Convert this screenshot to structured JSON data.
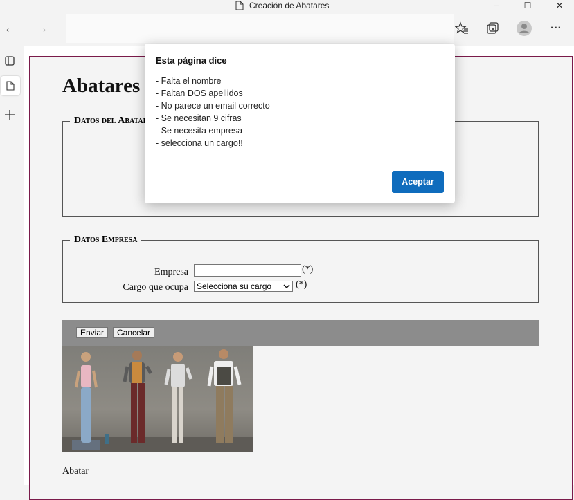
{
  "window": {
    "title": "Creación de Abatares",
    "minimize_icon": "─",
    "maximize_icon": "☐",
    "close_icon": "✕"
  },
  "toolbar": {
    "back_icon": "←",
    "forward_icon": "→",
    "more_icon": "···"
  },
  "page": {
    "title": "Abatares",
    "fieldset_datos_abatar": "Datos del Abatar",
    "fieldset_datos_empresa": "Datos Empresa",
    "empresa_label": "Empresa",
    "empresa_value": "",
    "empresa_required": "(*)",
    "cargo_label": "Cargo que ocupa",
    "cargo_selected": "Selecciona su cargo",
    "cargo_required": "(*)",
    "enviar_label": "Enviar",
    "cancelar_label": "Cancelar",
    "image_caption": "Abatar"
  },
  "dialog": {
    "title": "Esta página dice",
    "lines": [
      "- Falta el nombre",
      "- Faltan DOS apellidos",
      "- No parece un email correcto",
      "- Se necesitan 9 cifras",
      "- Se necesita empresa",
      "- selecciona un cargo!!"
    ],
    "ok_label": "Aceptar"
  },
  "colors": {
    "accent": "#0f6cbd",
    "page_border": "#7a1a4a",
    "button_bar": "#8c8c8c"
  }
}
